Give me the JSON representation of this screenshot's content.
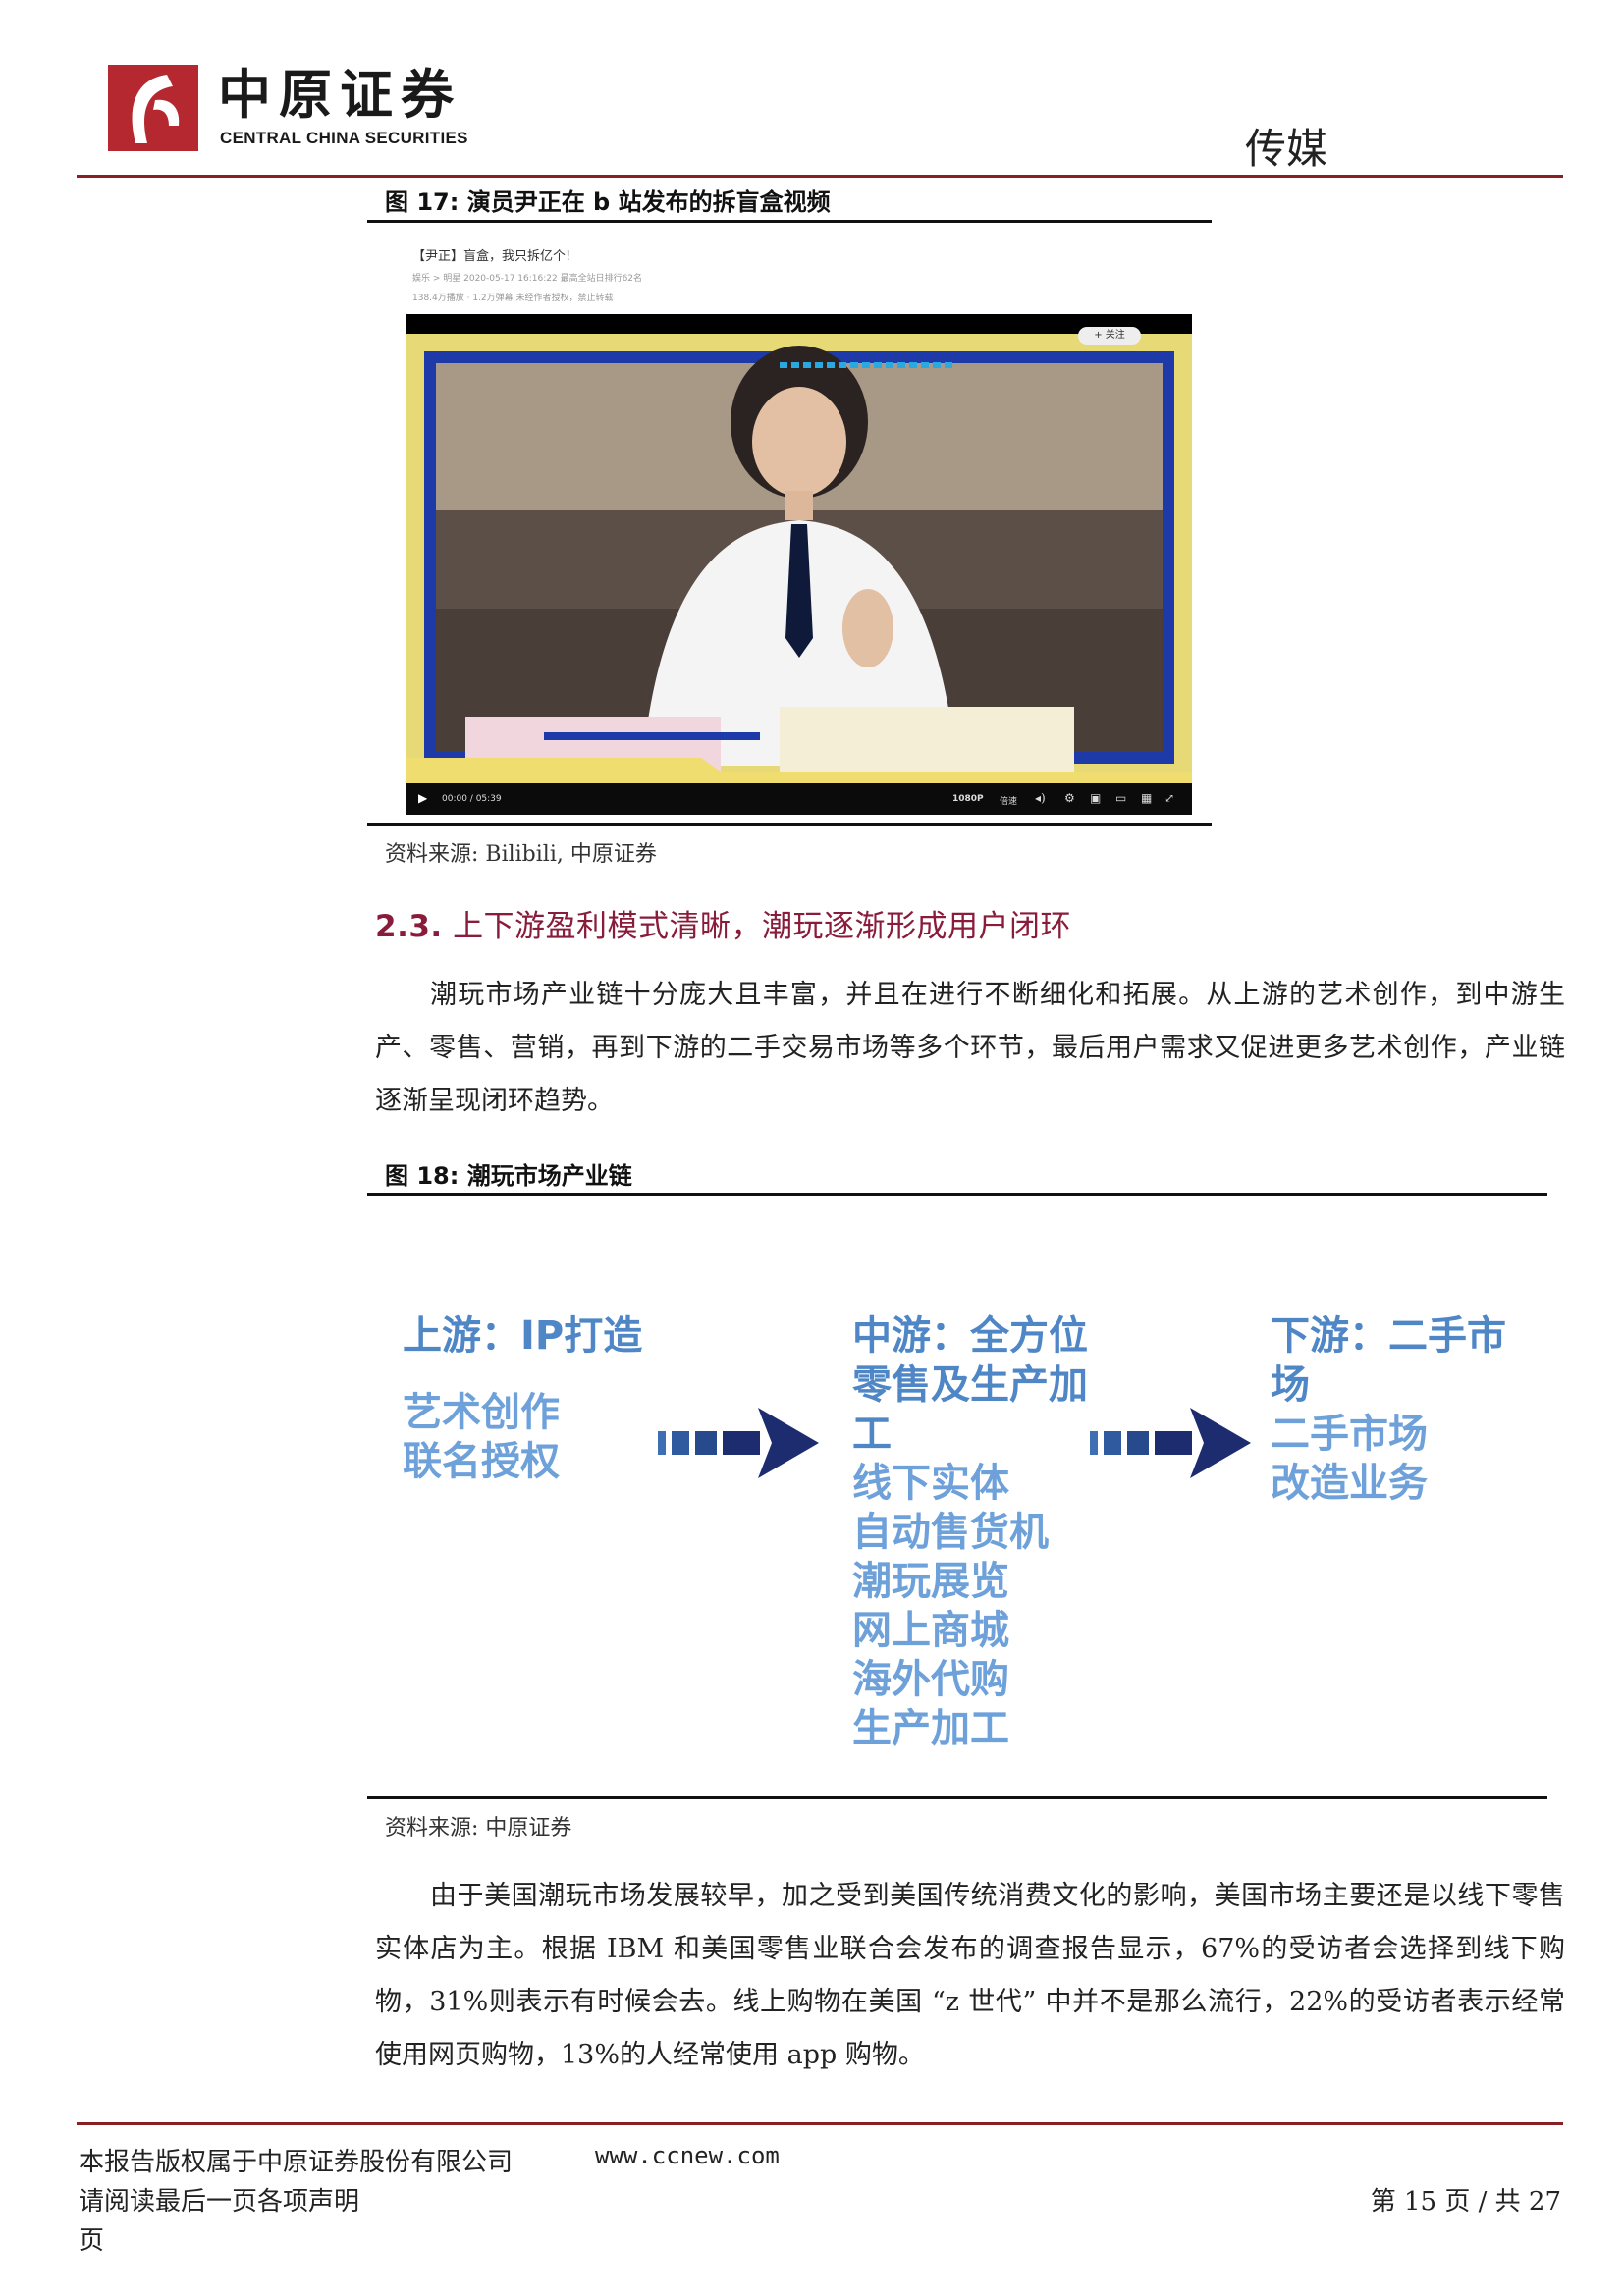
{
  "header": {
    "logo_cn": "中原证券",
    "logo_en": "CENTRAL CHINA SECURITIES",
    "section": "传媒"
  },
  "figure17": {
    "title": "图 17:  演员尹正在 b 站发布的拆盲盒视频",
    "source": "资料来源:  Bilibili, 中原证券",
    "video": {
      "title": "【尹正】盲盒，我只拆亿个!",
      "meta1": "娱乐 > 明星    2020-05-17 16:16:22  最高全站日排行62名",
      "meta2": "138.4万播放 · 1.2万弹幕     未经作者授权，禁止转载",
      "follow": "+ 关注",
      "time": "00:00 / 05:39",
      "quality": "1080P",
      "speed": "倍速"
    }
  },
  "section": {
    "number": "2.3.",
    "title": "上下游盈利模式清晰，潮玩逐渐形成用户闭环"
  },
  "para1": "潮玩市场产业链十分庞大且丰富，并且在进行不断细化和拓展。从上游的艺术创作，到中游生产、零售、营销，再到下游的二手交易市场等多个环节，最后用户需求又促进更多艺术创作，产业链逐渐呈现闭环趋势。",
  "figure18": {
    "title": "图 18:  潮玩市场产业链",
    "source": "资料来源:  中原证券",
    "upstream": {
      "head": "上游：IP打造",
      "items": [
        "艺术创作",
        "联名授权"
      ]
    },
    "midstream": {
      "head_lines": [
        "中游：全方位",
        "零售及生产加",
        "工"
      ],
      "items": [
        "线下实体",
        "自动售货机",
        "潮玩展览",
        "网上商城",
        "海外代购",
        "生产加工"
      ]
    },
    "downstream": {
      "head_lines": [
        "下游：二手市",
        "场"
      ],
      "items": [
        "二手市场",
        "改造业务"
      ]
    },
    "colors": {
      "head": "#4f86c6",
      "item": "#6ea1da",
      "arrow": "#1c2c6e"
    }
  },
  "para2": "由于美国潮玩市场发展较早，加之受到美国传统消费文化的影响，美国市场主要还是以线下零售实体店为主。根据 IBM 和美国零售业联合会发布的调查报告显示，67%的受访者会选择到线下购物，31%则表示有时候会去。线上购物在美国 “z 世代” 中并不是那么流行，22%的受访者表示经常使用网页购物，13%的人经常使用 app 购物。",
  "footer": {
    "copyright": "本报告版权属于中原证券股份有限公司",
    "url": "www.ccnew.com",
    "notice": "请阅读最后一页各项声明",
    "page": "第 15 页 / 共 27",
    "page_tail": "页"
  }
}
